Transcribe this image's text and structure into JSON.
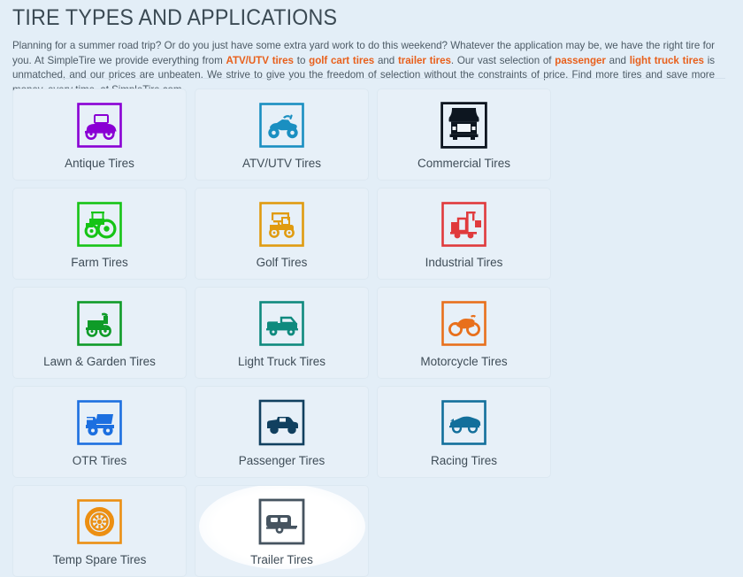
{
  "header": {
    "title": "TIRE TYPES AND APPLICATIONS",
    "intro_segments": [
      {
        "text": "Planning for a summer road trip?  Or do you just have some extra yard work to do this weekend?  Whatever the application may be, we have the right tire for you.  At SimpleTire we provide everything from ",
        "link": false
      },
      {
        "text": "ATV/UTV tires",
        "link": true
      },
      {
        "text": " to ",
        "link": false
      },
      {
        "text": "golf cart tires",
        "link": true
      },
      {
        "text": " and ",
        "link": false
      },
      {
        "text": "trailer tires",
        "link": true
      },
      {
        "text": ".  Our vast selection of ",
        "link": false
      },
      {
        "text": "passenger",
        "link": true
      },
      {
        "text": " and ",
        "link": false
      },
      {
        "text": "light truck tires",
        "link": true
      },
      {
        "text": " is unmatched, and our prices are unbeaten.  We strive to give you the freedom of selection without the constraints of price.  Find more tires and save more money, every time, at SimpleTire.com.",
        "link": false
      }
    ]
  },
  "colors": {
    "page_background": "#e3eef7",
    "card_background": "#e7f0f8",
    "card_border": "#dce8f1",
    "title_text": "#3b4a54",
    "body_text": "#4d5b66",
    "link_orange": "#e8601c",
    "label_text": "#3f4d58"
  },
  "grid": {
    "cards": [
      {
        "label": "Antique Tires",
        "icon": "antique-car-icon",
        "color": "#8a00d4",
        "hovered": false
      },
      {
        "label": "ATV/UTV Tires",
        "icon": "atv-quad-icon",
        "color": "#1a8fc1",
        "hovered": false
      },
      {
        "label": "Commercial Tires",
        "icon": "semi-truck-icon",
        "color": "#0d1620",
        "hovered": false
      },
      {
        "label": "Farm Tires",
        "icon": "tractor-icon",
        "color": "#16c416",
        "hovered": false
      },
      {
        "label": "Golf Tires",
        "icon": "golf-cart-icon",
        "color": "#e09b10",
        "hovered": false
      },
      {
        "label": "Industrial Tires",
        "icon": "forklift-icon",
        "color": "#e03a3c",
        "hovered": false
      },
      {
        "label": "Lawn & Garden Tires",
        "icon": "lawn-mower-icon",
        "color": "#0f9b28",
        "hovered": false
      },
      {
        "label": "Light Truck Tires",
        "icon": "pickup-truck-icon",
        "color": "#0f8a7e",
        "hovered": false
      },
      {
        "label": "Motorcycle Tires",
        "icon": "motorcycle-icon",
        "color": "#e8701c",
        "hovered": false
      },
      {
        "label": "OTR Tires",
        "icon": "dump-truck-icon",
        "color": "#1c6fe0",
        "hovered": false
      },
      {
        "label": "Passenger Tires",
        "icon": "passenger-car-icon",
        "color": "#11405f",
        "hovered": false
      },
      {
        "label": "Racing Tires",
        "icon": "race-car-icon",
        "color": "#126f9b",
        "hovered": false
      },
      {
        "label": "Temp Spare Tires",
        "icon": "spare-wheel-icon",
        "color": "#ec8f12",
        "hovered": false
      },
      {
        "label": "Trailer Tires",
        "icon": "trailer-icon",
        "color": "#465460",
        "hovered": true
      }
    ]
  }
}
